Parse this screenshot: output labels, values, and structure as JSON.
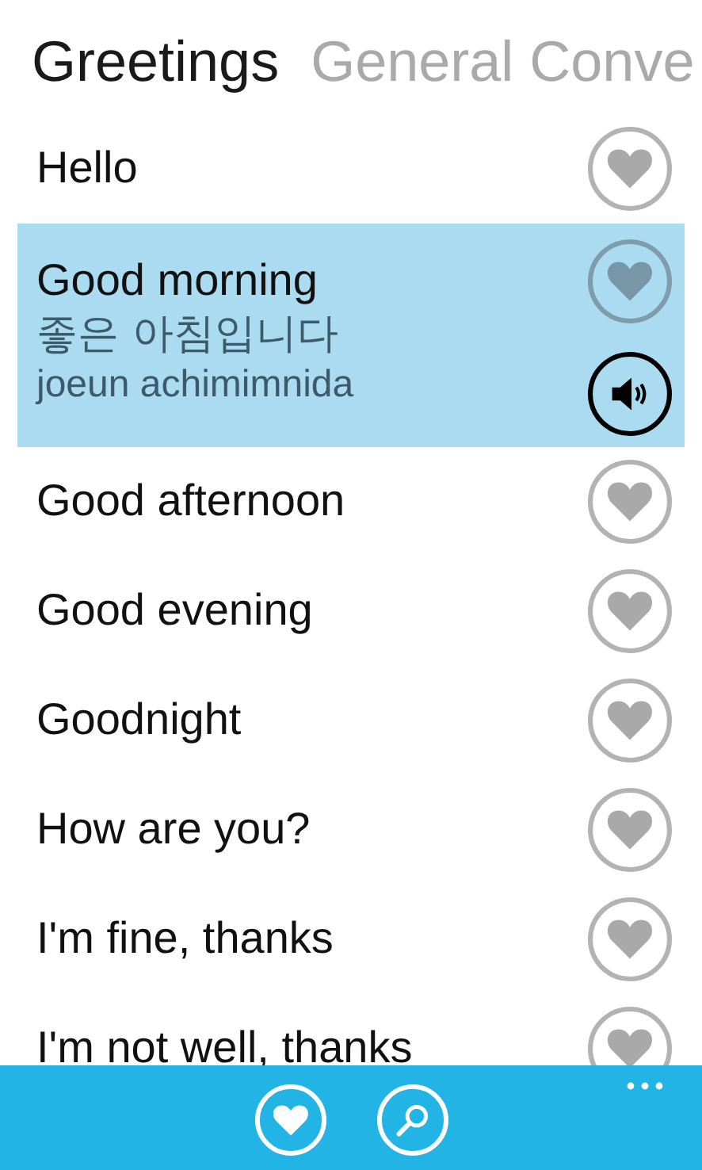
{
  "pivot_headers": [
    {
      "label": "Greetings",
      "selected": true
    },
    {
      "label": "General Conve",
      "selected": false
    }
  ],
  "phrases": [
    {
      "text": "Hello",
      "selected": false
    },
    {
      "text": "Good morning",
      "selected": true,
      "translation": "좋은 아침입니다",
      "romanization": "joeun achimimnida"
    },
    {
      "text": "Good afternoon",
      "selected": false
    },
    {
      "text": "Good evening",
      "selected": false
    },
    {
      "text": "Goodnight",
      "selected": false
    },
    {
      "text": "How are you?",
      "selected": false
    },
    {
      "text": "I'm fine, thanks",
      "selected": false
    },
    {
      "text": "I'm not well, thanks",
      "selected": false
    }
  ],
  "app_bar": {
    "buttons": [
      {
        "kind": "favorites"
      },
      {
        "kind": "search"
      }
    ]
  }
}
